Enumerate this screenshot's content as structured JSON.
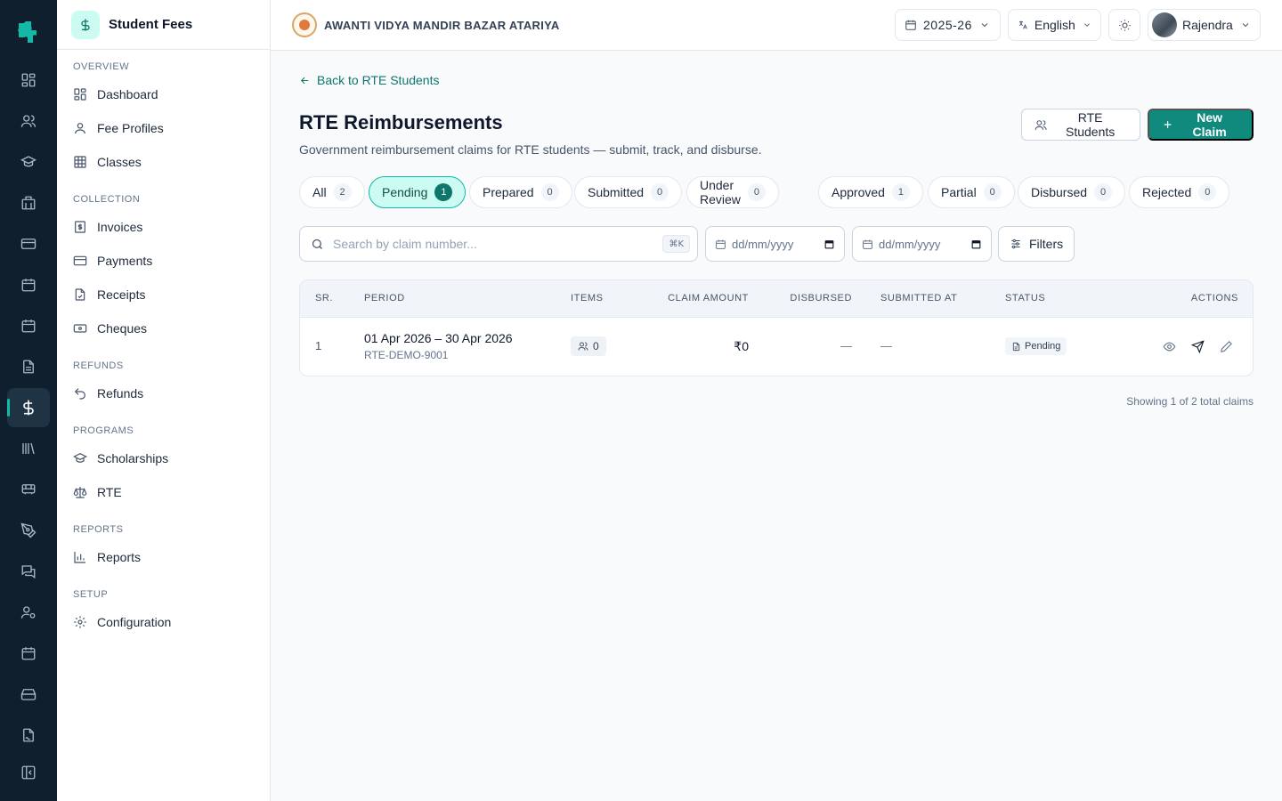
{
  "rail": {
    "icons": [
      "dashboard-grid-icon",
      "users-icon",
      "graduation-cap-icon",
      "building-icon",
      "credit-card-icon",
      "calendar-icon",
      "calendar-check-icon",
      "file-text-icon",
      "dollar-icon",
      "library-icon",
      "bus-icon",
      "pen-tool-icon",
      "messages-icon",
      "user-settings-icon",
      "calendar-days-icon",
      "hard-drive-icon",
      "file-signature-icon",
      "collapse-icon"
    ],
    "active": "dollar-icon"
  },
  "sidebar": {
    "title": "Student Fees",
    "sections": {
      "overview": "OVERVIEW",
      "collection": "COLLECTION",
      "refunds": "REFUNDS",
      "programs": "PROGRAMS",
      "reports": "REPORTS",
      "setup": "SETUP"
    },
    "items": {
      "dashboard": "Dashboard",
      "fee_profiles": "Fee Profiles",
      "classes": "Classes",
      "invoices": "Invoices",
      "payments": "Payments",
      "receipts": "Receipts",
      "cheques": "Cheques",
      "refunds": "Refunds",
      "scholarships": "Scholarships",
      "rte": "RTE",
      "reports": "Reports",
      "configuration": "Configuration"
    }
  },
  "topbar": {
    "school_name": "AWANTI VIDYA MANDIR BAZAR ATARIYA",
    "year": "2025-26",
    "language": "English",
    "user": "Rajendra"
  },
  "page": {
    "back_label": "Back to RTE Students",
    "title": "RTE Reimbursements",
    "subtitle": "Government reimbursement claims for RTE students — submit, track, and disburse.",
    "rte_students_button": "RTE Students",
    "new_claim_button": "New Claim"
  },
  "tabs": [
    {
      "label": "All",
      "count": "2"
    },
    {
      "label": "Pending",
      "count": "1"
    },
    {
      "label": "Prepared",
      "count": "0"
    },
    {
      "label": "Submitted",
      "count": "0"
    },
    {
      "label": "Under Review",
      "count": "0"
    },
    {
      "label": "Approved",
      "count": "1"
    },
    {
      "label": "Partial",
      "count": "0"
    },
    {
      "label": "Disbursed",
      "count": "0"
    },
    {
      "label": "Rejected",
      "count": "0"
    }
  ],
  "active_tab": "Pending",
  "filters": {
    "search_placeholder": "Search by claim number...",
    "search_shortcut": "⌘K",
    "date_from_placeholder": "dd/mm/yyyy",
    "date_to_placeholder": "dd/mm/yyyy",
    "filters_label": "Filters"
  },
  "table": {
    "headers": {
      "sr": "SR.",
      "period": "PERIOD",
      "items": "ITEMS",
      "claim_amount": "CLAIM AMOUNT",
      "disbursed": "DISBURSED",
      "submitted_at": "SUBMITTED AT",
      "status": "STATUS",
      "actions": "ACTIONS"
    },
    "rows": [
      {
        "sr": "1",
        "period": "01 Apr 2026 – 30 Apr 2026",
        "claim_number": "RTE-DEMO-9001",
        "items": "0",
        "claim_amount": "₹0",
        "disbursed": "—",
        "submitted_at": "—",
        "status": "Pending"
      }
    ]
  },
  "footer": {
    "showing": "Showing 1 of 2 total claims"
  },
  "colors": {
    "primary": "#0f8a7d",
    "rail_bg": "#0f1f2e",
    "active_tab_bg": "#ccfbf1",
    "active_tab_border": "#14b8a6"
  }
}
